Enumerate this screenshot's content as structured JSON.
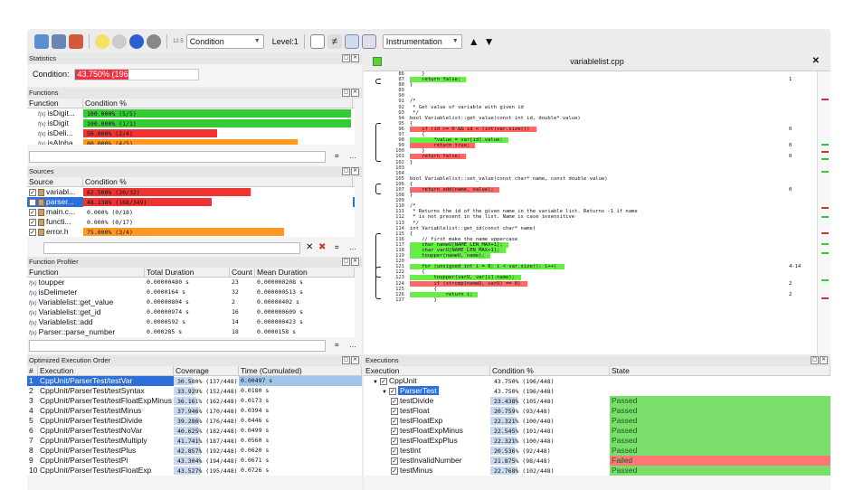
{
  "toolbar": {
    "condition_label": "Condition",
    "level_label": "Level:1",
    "instrumentation_label": "Instrumentation",
    "zoom_label": "12.5"
  },
  "statistics": {
    "title": "Statistics",
    "condition_label": "Condition:",
    "condition_value": "43.750% (196/448)",
    "fill": 0.4375
  },
  "functions": {
    "title": "Functions",
    "col_function": "Function",
    "col_condition": "Condition %",
    "rows": [
      {
        "name": "isDigit...",
        "value": "100.000% (5/5)",
        "fill": 1.0,
        "color": "#33cc33"
      },
      {
        "name": "isDigit",
        "value": "100.000% (1/1)",
        "fill": 1.0,
        "color": "#33cc33"
      },
      {
        "name": "isDeli...",
        "value": "50.000% (2/4)",
        "fill": 0.5,
        "color": "#ee3333"
      },
      {
        "name": "isAlpha",
        "value": "80.000% (4/5)",
        "fill": 0.8,
        "color": "#ff9922"
      }
    ]
  },
  "sources": {
    "title": "Sources",
    "col_source": "Source",
    "col_condition": "Condition %",
    "rows": [
      {
        "name": "variabl...",
        "value": "62.500% (20/32)",
        "fill": 0.625,
        "color": "#ee3333",
        "selected": false
      },
      {
        "name": "parser...",
        "value": "48.138% (168/349)",
        "fill": 0.48,
        "color": "#ee3333",
        "selected": true
      },
      {
        "name": "main.c...",
        "value": "0.000% (0/18)",
        "fill": 0,
        "color": "#ee3333",
        "selected": false
      },
      {
        "name": "functi...",
        "value": "0.000% (0/17)",
        "fill": 0,
        "color": "#ee3333",
        "selected": false
      },
      {
        "name": "error.h",
        "value": "75.000% (3/4)",
        "fill": 0.75,
        "color": "#ff9922",
        "selected": false
      }
    ]
  },
  "profiler": {
    "title": "Function Profiler",
    "col_function": "Function",
    "col_total": "Total Duration",
    "col_count": "Count",
    "col_mean": "Mean Duration",
    "rows": [
      {
        "name": "toupper",
        "total": "0.00000480 s",
        "count": "23",
        "mean": "0.000000208 s"
      },
      {
        "name": "isDelimeter",
        "total": "0.0000164 s",
        "count": "32",
        "mean": "0.000000513 s"
      },
      {
        "name": "Variablelist::get_value",
        "total": "0.00000804 s",
        "count": "2",
        "mean": "0.00000402 s"
      },
      {
        "name": "Variablelist::get_id",
        "total": "0.00000974 s",
        "count": "16",
        "mean": "0.000000609 s"
      },
      {
        "name": "Variablelist::add",
        "total": "0.0000592 s",
        "count": "14",
        "mean": "0.000000423 s"
      },
      {
        "name": "Parser::parse_number",
        "total": "0.000285 s",
        "count": "18",
        "mean": "0.0000158 s"
      }
    ]
  },
  "execorder": {
    "title": "Optimized Execution Order",
    "col_num": "#",
    "col_exec": "Execution",
    "col_cov": "Coverage",
    "col_time": "Time (Cumulated)",
    "rows": [
      {
        "n": "1",
        "name": "CppUnit/ParserTest/testVar",
        "cov": "30.580% (137/448)",
        "time": "0.00497 s",
        "fill": 0.3058,
        "sel": true
      },
      {
        "n": "2",
        "name": "CppUnit/ParserTest/testSyntax",
        "cov": "33.929% (152/448)",
        "time": "0.0180 s",
        "fill": 0.339
      },
      {
        "n": "3",
        "name": "CppUnit/ParserTest/testFloatExpMinus",
        "cov": "36.161% (162/448)",
        "time": "0.0173 s",
        "fill": 0.3616
      },
      {
        "n": "4",
        "name": "CppUnit/ParserTest/testMinus",
        "cov": "37.946% (170/448)",
        "time": "0.0394 s",
        "fill": 0.379
      },
      {
        "n": "5",
        "name": "CppUnit/ParserTest/testDivide",
        "cov": "39.286% (176/448)",
        "time": "0.0446 s",
        "fill": 0.393
      },
      {
        "n": "6",
        "name": "CppUnit/ParserTest/testNoVar",
        "cov": "40.625% (182/448)",
        "time": "0.0499 s",
        "fill": 0.406
      },
      {
        "n": "7",
        "name": "CppUnit/ParserTest/testMultiply",
        "cov": "41.741% (187/448)",
        "time": "0.0560 s",
        "fill": 0.417
      },
      {
        "n": "8",
        "name": "CppUnit/ParserTest/testPlus",
        "cov": "42.857% (192/448)",
        "time": "0.0620 s",
        "fill": 0.428
      },
      {
        "n": "9",
        "name": "CppUnit/ParserTest/testPi",
        "cov": "43.304% (194/448)",
        "time": "0.0671 s",
        "fill": 0.433
      },
      {
        "n": "10",
        "name": "CppUnit/ParserTest/testFloatExp",
        "cov": "43.527% (195/448)",
        "time": "0.0726 s",
        "fill": 0.435
      }
    ]
  },
  "executions": {
    "title": "Executions",
    "col_exec": "Execution",
    "col_cond": "Condition %",
    "col_state": "State",
    "rows": [
      {
        "name": "CppUnit",
        "cond": "43.750% (196/448)",
        "state": "",
        "indent": 1,
        "fill": 0,
        "sel": false
      },
      {
        "name": "ParserTest",
        "cond": "43.750% (196/448)",
        "state": "",
        "indent": 2,
        "fill": 0,
        "sel": true
      },
      {
        "name": "testDivide",
        "cond": "23.438% (105/448)",
        "state": "Passed",
        "indent": 3,
        "fill": 0.234
      },
      {
        "name": "testFloat",
        "cond": "20.759% (93/448)",
        "state": "Passed",
        "indent": 3,
        "fill": 0.207
      },
      {
        "name": "testFloatExp",
        "cond": "22.321% (100/448)",
        "state": "Passed",
        "indent": 3,
        "fill": 0.223
      },
      {
        "name": "testFloatExpMinus",
        "cond": "22.545% (101/448)",
        "state": "Passed",
        "indent": 3,
        "fill": 0.225
      },
      {
        "name": "testFloatExpPlus",
        "cond": "22.321% (100/448)",
        "state": "Passed",
        "indent": 3,
        "fill": 0.223
      },
      {
        "name": "testInt",
        "cond": "20.536% (92/448)",
        "state": "Passed",
        "indent": 3,
        "fill": 0.205
      },
      {
        "name": "testInvalidNumber",
        "cond": "21.875% (98/448)",
        "state": "Failed",
        "indent": 3,
        "fill": 0.218
      },
      {
        "name": "testMinus",
        "cond": "22.768% (102/448)",
        "state": "Passed",
        "indent": 3,
        "fill": 0.227
      }
    ]
  },
  "editor": {
    "filename": "variablelist.cpp",
    "close": "✕",
    "lines": [
      {
        "n": "86",
        "t": "    }",
        "hl": "",
        "c": ""
      },
      {
        "n": "87",
        "t": "    return false;",
        "hl": "g",
        "c": "1"
      },
      {
        "n": "88",
        "t": "}",
        "hl": "",
        "c": ""
      },
      {
        "n": "89",
        "t": "",
        "hl": "",
        "c": ""
      },
      {
        "n": "90",
        "t": "",
        "hl": "",
        "c": ""
      },
      {
        "n": "91",
        "t": "/*",
        "hl": "",
        "c": ""
      },
      {
        "n": "92",
        "t": " * Get value of variable with given id",
        "hl": "",
        "c": ""
      },
      {
        "n": "93",
        "t": " */",
        "hl": "",
        "c": ""
      },
      {
        "n": "94",
        "t": "bool Variablelist::get_value(const int id, double* value)",
        "hl": "",
        "c": ""
      },
      {
        "n": "95",
        "t": "{",
        "hl": "",
        "c": ""
      },
      {
        "n": "96",
        "t": "    if (id >= 0 && id < (int)var.size())",
        "hl": "r",
        "c": "0"
      },
      {
        "n": "97",
        "t": "    {",
        "hl": "",
        "c": ""
      },
      {
        "n": "98",
        "t": "        *value = var[id].value;",
        "hl": "g",
        "c": ""
      },
      {
        "n": "99",
        "t": "        return true;",
        "hl": "r",
        "c": "0"
      },
      {
        "n": "100",
        "t": "    }",
        "hl": "",
        "c": ""
      },
      {
        "n": "101",
        "t": "    return false;",
        "hl": "r",
        "c": "0"
      },
      {
        "n": "102",
        "t": "}",
        "hl": "",
        "c": ""
      },
      {
        "n": "103",
        "t": "",
        "hl": "",
        "c": ""
      },
      {
        "n": "104",
        "t": "",
        "hl": "",
        "c": ""
      },
      {
        "n": "105",
        "t": "bool Variablelist::set_value(const char* name, const double value)",
        "hl": "",
        "c": ""
      },
      {
        "n": "106",
        "t": "{",
        "hl": "",
        "c": ""
      },
      {
        "n": "107",
        "t": "    return add(name, value);",
        "hl": "r",
        "c": "0"
      },
      {
        "n": "108",
        "t": "}",
        "hl": "",
        "c": ""
      },
      {
        "n": "109",
        "t": "",
        "hl": "",
        "c": ""
      },
      {
        "n": "110",
        "t": "/*",
        "hl": "",
        "c": ""
      },
      {
        "n": "111",
        "t": " * Returns the id of the given name in the variable list. Returns -1 if name",
        "hl": "",
        "c": ""
      },
      {
        "n": "112",
        "t": " * is not present in the list. Name is case insensitive",
        "hl": "",
        "c": ""
      },
      {
        "n": "113",
        "t": " */",
        "hl": "",
        "c": ""
      },
      {
        "n": "114",
        "t": "int Variablelist::get_id(const char* name)",
        "hl": "",
        "c": ""
      },
      {
        "n": "115",
        "t": "{",
        "hl": "",
        "c": ""
      },
      {
        "n": "116",
        "t": "    // first make the name uppercase",
        "hl": "",
        "c": ""
      },
      {
        "n": "117",
        "t": "    char nameU[NAME_LEN_MAX+1];",
        "hl": "g",
        "c": ""
      },
      {
        "n": "118",
        "t": "    char varU[NAME_LEN_MAX+1];",
        "hl": "g",
        "c": ""
      },
      {
        "n": "119",
        "t": "    toupper(nameU, name);",
        "hl": "g",
        "c": ""
      },
      {
        "n": "120",
        "t": "",
        "hl": "",
        "c": ""
      },
      {
        "n": "121",
        "t": "    for (unsigned int i = 0; i < var.size(); i++)",
        "hl": "g",
        "c": "4-14"
      },
      {
        "n": "122",
        "t": "    {",
        "hl": "",
        "c": ""
      },
      {
        "n": "123",
        "t": "        toupper(varU, var[i].name);",
        "hl": "g",
        "c": ""
      },
      {
        "n": "124",
        "t": "        if (strcmp(nameU, varU) == 0)",
        "hl": "r",
        "c": "2"
      },
      {
        "n": "125",
        "t": "        {",
        "hl": "",
        "c": ""
      },
      {
        "n": "126",
        "t": "            return i;",
        "hl": "g",
        "c": "2"
      },
      {
        "n": "127",
        "t": "        }",
        "hl": "",
        "c": ""
      }
    ]
  }
}
